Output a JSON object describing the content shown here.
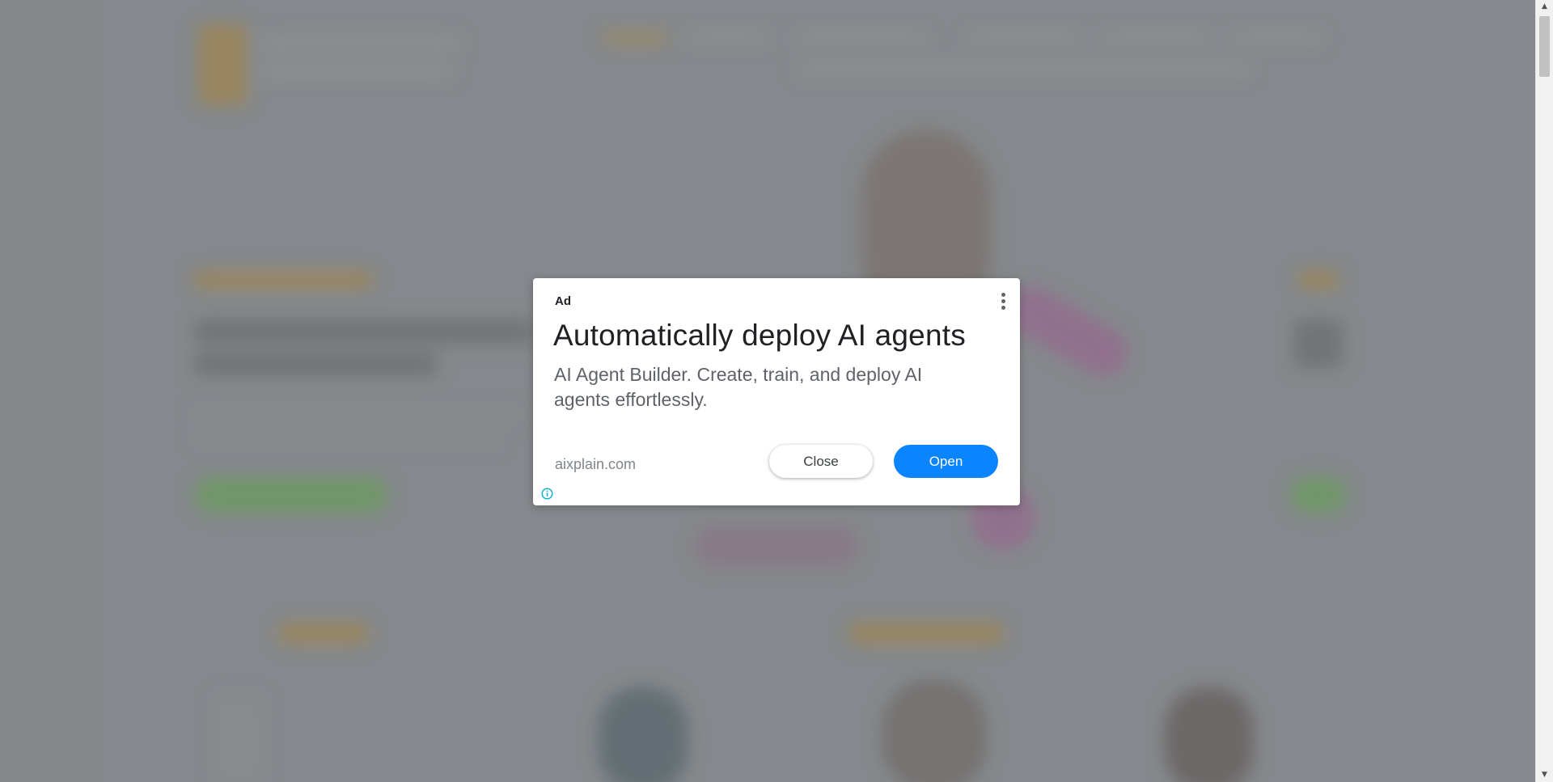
{
  "ad": {
    "label": "Ad",
    "headline": "Automatically deploy AI agents",
    "body": "AI Agent Builder. Create, train, and deploy AI agents effortlessly.",
    "domain": "aixplain.com",
    "close_label": "Close",
    "open_label": "Open",
    "icons": {
      "menu": "more-vert-icon",
      "info": "info-icon"
    }
  },
  "colors": {
    "open_button": "#0a84ff",
    "backdrop": "#8a8d90",
    "info_icon": "#00aecd"
  },
  "scrollbar": {
    "up_arrow": "▲",
    "down_arrow": "▼"
  }
}
